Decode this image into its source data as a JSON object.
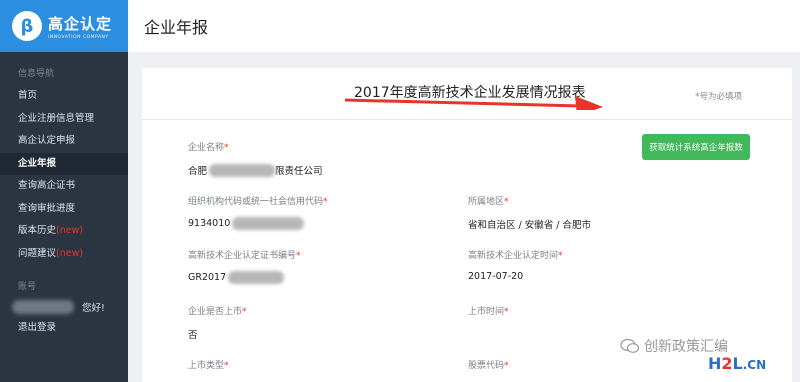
{
  "sidebar": {
    "logo_title": "高企认定",
    "logo_subtitle": "INNOVATION COMPANY",
    "section_label": "信息导航",
    "items": [
      {
        "label": "首页"
      },
      {
        "label": "企业注册信息管理"
      },
      {
        "label": "高企认定申报"
      },
      {
        "label": "企业年报"
      },
      {
        "label": "查询高企证书"
      },
      {
        "label": "查询审批进度"
      },
      {
        "label": "版本历史",
        "badge": "(new)"
      },
      {
        "label": "问题建议",
        "badge": "(new)"
      }
    ],
    "account_label": "账号",
    "greeting": "您好!",
    "logout_label": "退出登录"
  },
  "header": {
    "title": "企业年报"
  },
  "report": {
    "title": "2017年度高新技术企业发展情况报表",
    "required_note": "*号为必填项",
    "sync_button": "获取统计系统高企年报数",
    "fields": {
      "company_name": {
        "label": "企业名称",
        "value_prefix": "合肥",
        "value_suffix": "限责任公司"
      },
      "credit_code": {
        "label": "组织机构代码或统一社会信用代码",
        "value_prefix": "9134010"
      },
      "region": {
        "label": "所属地区",
        "value": "省和自治区 / 安徽省 / 合肥市"
      },
      "cert_no": {
        "label": "高新技术企业认定证书编号",
        "value_prefix": "GR2017"
      },
      "cert_date": {
        "label": "高新技术企业认定时间",
        "value": "2017-07-20"
      },
      "listed": {
        "label": "企业是否上市",
        "value": "否"
      },
      "listed_time": {
        "label": "上市时间"
      },
      "listed_type": {
        "label": "上市类型"
      },
      "stock_code": {
        "label": "股票代码"
      }
    }
  },
  "watermark": {
    "text": "创新政策汇编",
    "site_prefix": "H",
    "site_two": "2",
    "site_suffix": "L",
    "site_cn": ".CN"
  },
  "colors": {
    "sidebar": "#2b3542",
    "accent": "#2b8ee0",
    "button": "#41b95a",
    "arrow": "#e8342a"
  }
}
